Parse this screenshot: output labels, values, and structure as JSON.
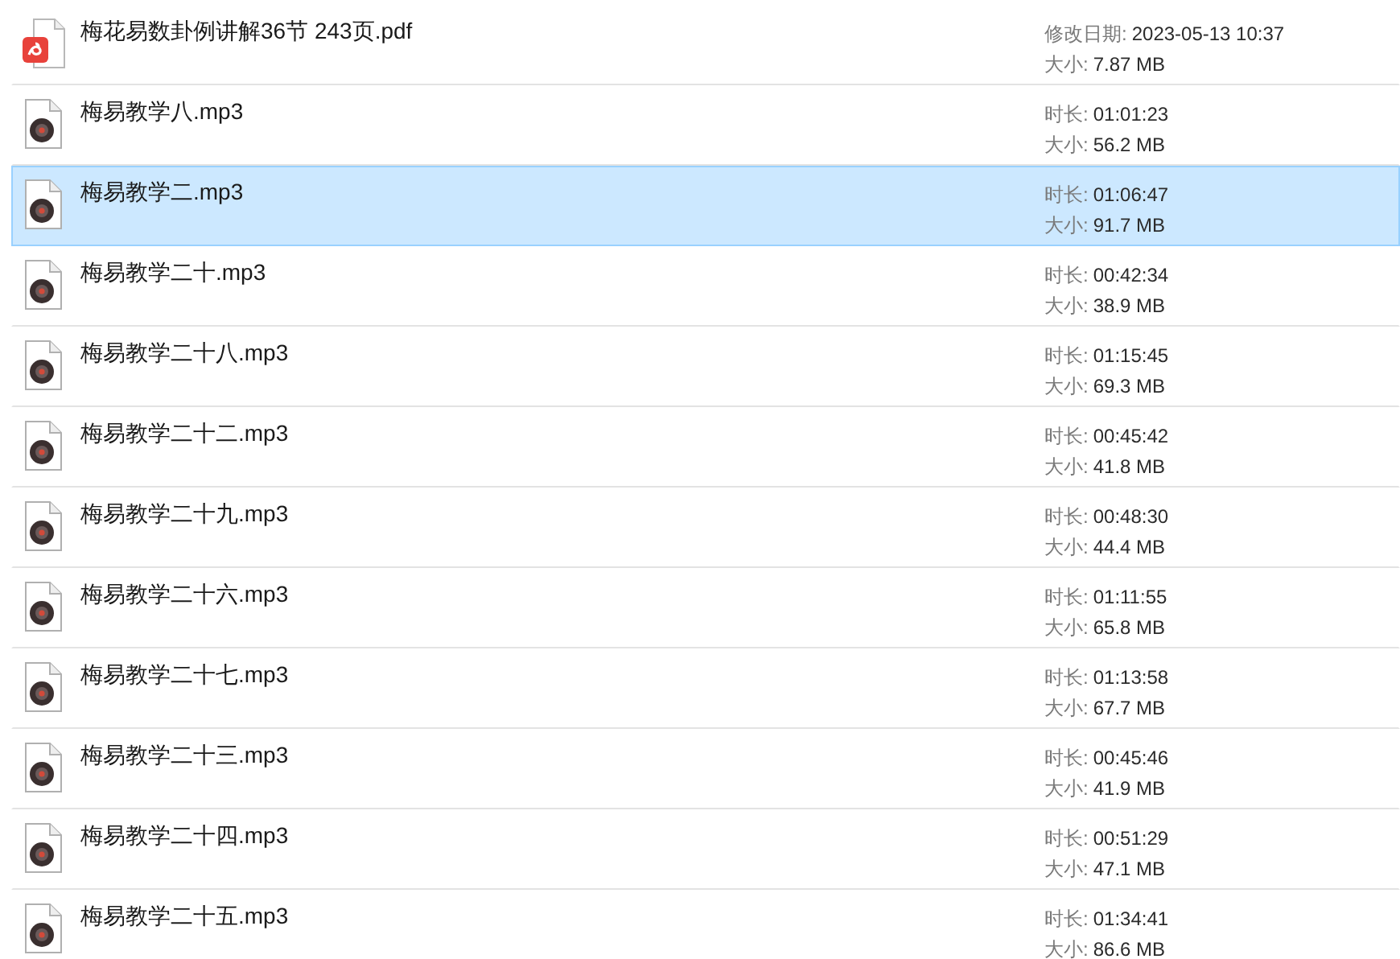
{
  "files": [
    {
      "kind": "pdf",
      "name": "梅花易数卦例讲解36节 243页.pdf",
      "selected": false,
      "details": [
        {
          "label": "修改日期:",
          "value": "2023-05-13 10:37"
        },
        {
          "label": "大小:",
          "value": "7.87 MB"
        }
      ]
    },
    {
      "kind": "audio",
      "name": "梅易教学八.mp3",
      "selected": false,
      "details": [
        {
          "label": "时长:",
          "value": "01:01:23"
        },
        {
          "label": "大小:",
          "value": "56.2 MB"
        }
      ]
    },
    {
      "kind": "audio",
      "name": "梅易教学二.mp3",
      "selected": true,
      "details": [
        {
          "label": "时长:",
          "value": "01:06:47"
        },
        {
          "label": "大小:",
          "value": "91.7 MB"
        }
      ]
    },
    {
      "kind": "audio",
      "name": "梅易教学二十.mp3",
      "selected": false,
      "details": [
        {
          "label": "时长:",
          "value": "00:42:34"
        },
        {
          "label": "大小:",
          "value": "38.9 MB"
        }
      ]
    },
    {
      "kind": "audio",
      "name": "梅易教学二十八.mp3",
      "selected": false,
      "details": [
        {
          "label": "时长:",
          "value": "01:15:45"
        },
        {
          "label": "大小:",
          "value": "69.3 MB"
        }
      ]
    },
    {
      "kind": "audio",
      "name": "梅易教学二十二.mp3",
      "selected": false,
      "details": [
        {
          "label": "时长:",
          "value": "00:45:42"
        },
        {
          "label": "大小:",
          "value": "41.8 MB"
        }
      ]
    },
    {
      "kind": "audio",
      "name": "梅易教学二十九.mp3",
      "selected": false,
      "details": [
        {
          "label": "时长:",
          "value": "00:48:30"
        },
        {
          "label": "大小:",
          "value": "44.4 MB"
        }
      ]
    },
    {
      "kind": "audio",
      "name": "梅易教学二十六.mp3",
      "selected": false,
      "details": [
        {
          "label": "时长:",
          "value": "01:11:55"
        },
        {
          "label": "大小:",
          "value": "65.8 MB"
        }
      ]
    },
    {
      "kind": "audio",
      "name": "梅易教学二十七.mp3",
      "selected": false,
      "details": [
        {
          "label": "时长:",
          "value": "01:13:58"
        },
        {
          "label": "大小:",
          "value": "67.7 MB"
        }
      ]
    },
    {
      "kind": "audio",
      "name": "梅易教学二十三.mp3",
      "selected": false,
      "details": [
        {
          "label": "时长:",
          "value": "00:45:46"
        },
        {
          "label": "大小:",
          "value": "41.9 MB"
        }
      ]
    },
    {
      "kind": "audio",
      "name": "梅易教学二十四.mp3",
      "selected": false,
      "details": [
        {
          "label": "时长:",
          "value": "00:51:29"
        },
        {
          "label": "大小:",
          "value": "47.1 MB"
        }
      ]
    },
    {
      "kind": "audio",
      "name": "梅易教学二十五.mp3",
      "selected": false,
      "details": [
        {
          "label": "时长:",
          "value": "01:34:41"
        },
        {
          "label": "大小:",
          "value": "86.6 MB"
        }
      ]
    }
  ]
}
